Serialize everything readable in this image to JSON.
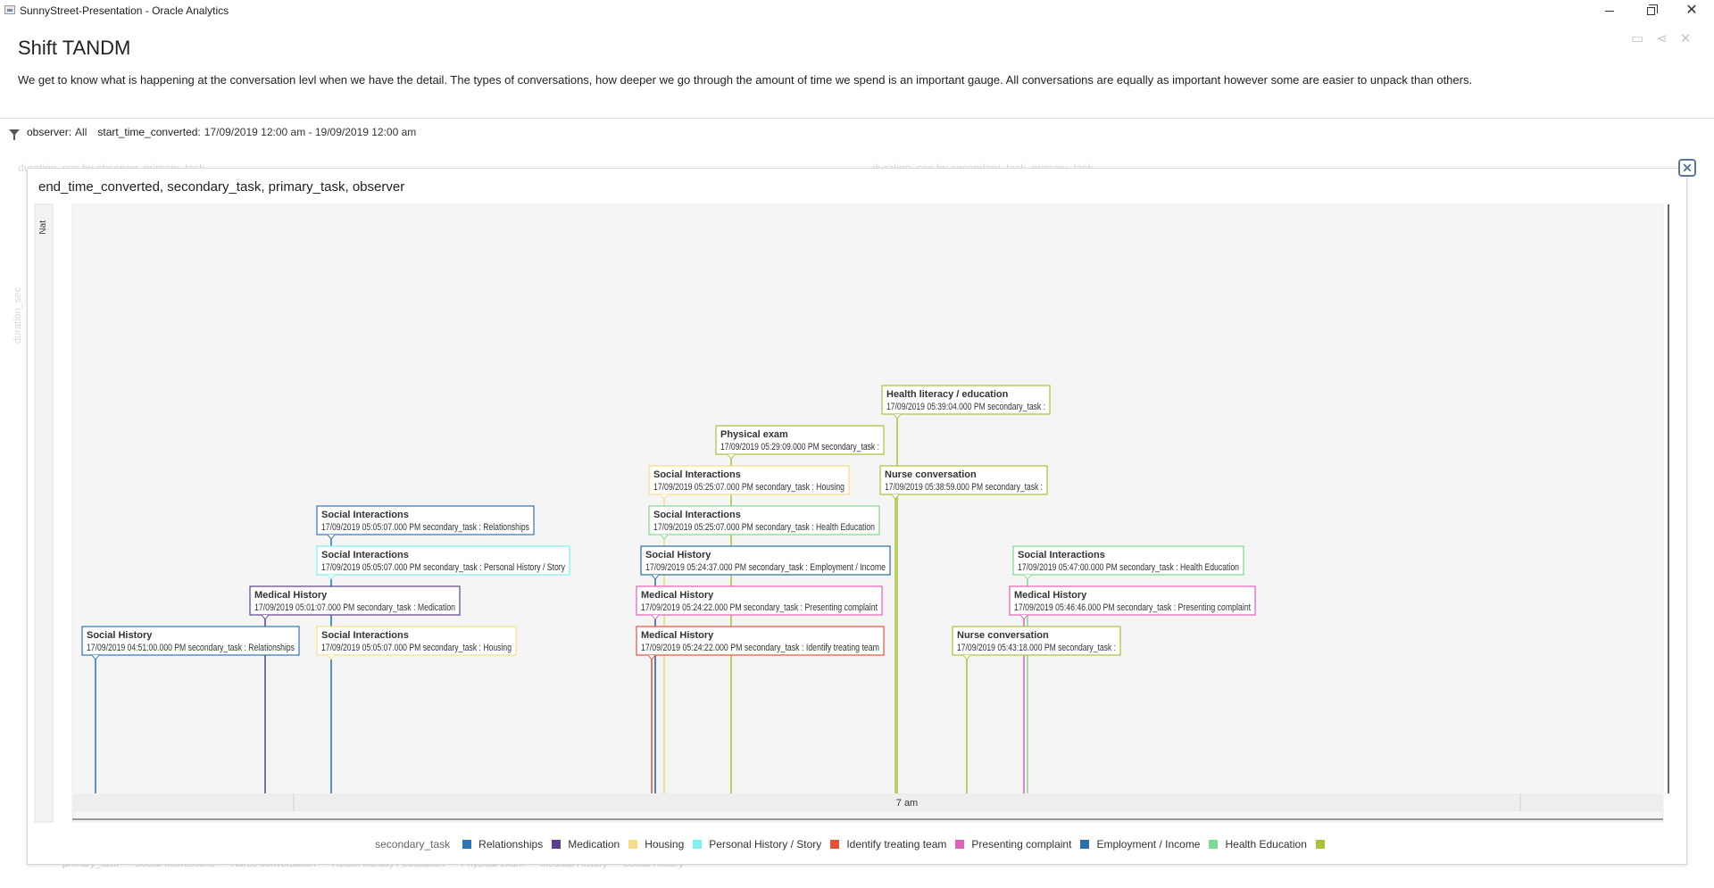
{
  "window": {
    "title": "SunnyStreet-Presentation - Oracle Analytics",
    "min": "—",
    "max": "▢",
    "close": "✕"
  },
  "page": {
    "title": "Shift TANDM",
    "description": "We get to know what is happening at the conversation levl when we have the detail. The types of conversations, how deeper we go through the amount of time we spend is an important gauge. All conversations are equally as important however some are easier to unpack than others."
  },
  "filters": [
    {
      "key": "observer:",
      "value": "All"
    },
    {
      "key": "start_time_converted:",
      "value": "17/09/2019 12:00 am - 19/09/2019 12:00 am"
    }
  ],
  "background": {
    "chart1_title": "duration_sec by observer, primary_task",
    "chart2_title": "duration_sec by secondary_task, primary_task",
    "y_label": "duration_sec",
    "legend": [
      "primary_task",
      "Social Interactions",
      "Nurse conversation",
      "Health literacy / education",
      "Physical exam",
      "Medical History",
      "Social History"
    ]
  },
  "viz": {
    "title": "end_time_converted, secondary_task, primary_task, observer",
    "close_icon": "✕",
    "row_label": "Nat",
    "axis_tick": "7 am"
  },
  "legend": {
    "title": "secondary_task",
    "items": [
      {
        "label": "Relationships",
        "color": "#2e75b6"
      },
      {
        "label": "Medication",
        "color": "#5d3f8e"
      },
      {
        "label": "Housing",
        "color": "#f7dc8c"
      },
      {
        "label": "Personal History / Story",
        "color": "#7ef0f0"
      },
      {
        "label": "Identify treating team",
        "color": "#e8503a"
      },
      {
        "label": "Presenting complaint",
        "color": "#e062b8"
      },
      {
        "label": "Employment / Income",
        "color": "#2b6ea8"
      },
      {
        "label": "Health Education",
        "color": "#7cdb8e"
      },
      {
        "label": "",
        "color": "#a8c23a"
      }
    ]
  },
  "chart_data": {
    "type": "timeline",
    "x_axis": {
      "ticks": [
        "7 am"
      ]
    },
    "events": [
      {
        "title": "Social History",
        "detail": "17/09/2019 04:51:00.000 PM secondary_task : Relationships",
        "color": "#2e75b6"
      },
      {
        "title": "Medical History",
        "detail": "17/09/2019 05:01:07.000 PM secondary_task : Medication",
        "color": "#5d3f8e"
      },
      {
        "title": "Social Interactions",
        "detail": "17/09/2019 05:05:07.000 PM secondary_task : Housing",
        "color": "#f7dc8c"
      },
      {
        "title": "Social Interactions",
        "detail": "17/09/2019 05:05:07.000 PM secondary_task : Personal History / Story",
        "color": "#7ef0f0"
      },
      {
        "title": "Social Interactions",
        "detail": "17/09/2019 05:05:07.000 PM secondary_task : Relationships",
        "color": "#2e75b6"
      },
      {
        "title": "Medical History",
        "detail": "17/09/2019 05:24:22.000 PM secondary_task : Identify treating team",
        "color": "#e8503a"
      },
      {
        "title": "Medical History",
        "detail": "17/09/2019 05:24:22.000 PM secondary_task : Presenting complaint",
        "color": "#e062b8"
      },
      {
        "title": "Social History",
        "detail": "17/09/2019 05:24:37.000 PM secondary_task : Employment / Income",
        "color": "#2b6ea8"
      },
      {
        "title": "Social Interactions",
        "detail": "17/09/2019 05:25:07.000 PM secondary_task : Health Education",
        "color": "#7cdb8e"
      },
      {
        "title": "Social Interactions",
        "detail": "17/09/2019 05:25:07.000 PM secondary_task : Housing",
        "color": "#f7dc8c"
      },
      {
        "title": "Physical exam",
        "detail": "17/09/2019 05:29:09.000 PM secondary_task :",
        "color": "#a8c23a"
      },
      {
        "title": "Nurse conversation",
        "detail": "17/09/2019 05:38:59.000 PM secondary_task :",
        "color": "#a8c23a"
      },
      {
        "title": "Health literacy / education",
        "detail": "17/09/2019 05:39:04.000 PM secondary_task :",
        "color": "#a8c23a"
      },
      {
        "title": "Nurse conversation",
        "detail": "17/09/2019 05:43:18.000 PM secondary_task :",
        "color": "#a8c23a"
      },
      {
        "title": "Medical History",
        "detail": "17/09/2019 05:46:46.000 PM secondary_task : Presenting complaint",
        "color": "#e062b8"
      },
      {
        "title": "Social Interactions",
        "detail": "17/09/2019 05:47:00.000 PM secondary_task : Health Education",
        "color": "#7cdb8e"
      }
    ]
  }
}
